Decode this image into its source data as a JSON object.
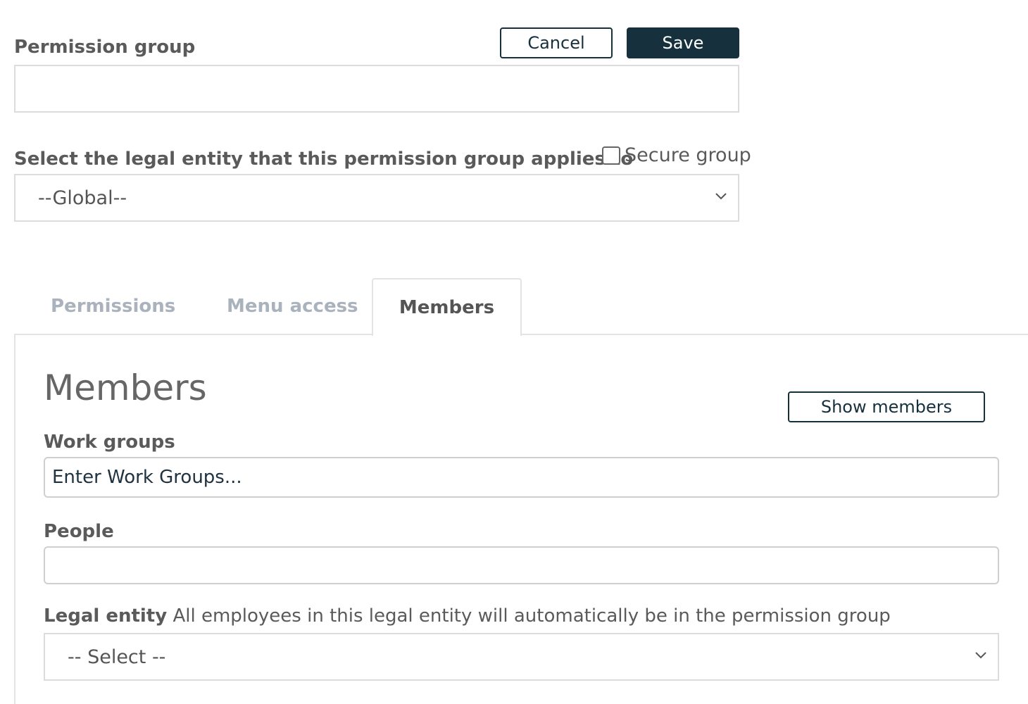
{
  "form": {
    "permission_group_label": "Permission group",
    "permission_group_value": "",
    "legal_entity_label": "Select the legal entity that this permission group applies to",
    "legal_entity_selected": "--Global--",
    "secure_group_label": "Secure group",
    "secure_group_checked": false
  },
  "actions": {
    "cancel_label": "Cancel",
    "save_label": "Save"
  },
  "tabs": [
    {
      "label": "Permissions",
      "active": false
    },
    {
      "label": "Menu access",
      "active": false
    },
    {
      "label": "Members",
      "active": true
    }
  ],
  "members": {
    "title": "Members",
    "show_members_label": "Show members",
    "work_groups_label": "Work groups",
    "work_groups_placeholder": "Enter Work Groups...",
    "people_label": "People",
    "people_value": "",
    "legal_entity_label": "Legal entity",
    "legal_entity_hint": "All employees in this legal entity will automatically be in the permission group",
    "legal_entity_selected": "-- Select --"
  },
  "icons": {
    "dropdown": "chevron-down-icon",
    "checkbox": "checkbox-icon"
  },
  "colors": {
    "primary": "#16303e",
    "tab_inactive": "#a9b2bd",
    "label": "#5a5a5a"
  }
}
